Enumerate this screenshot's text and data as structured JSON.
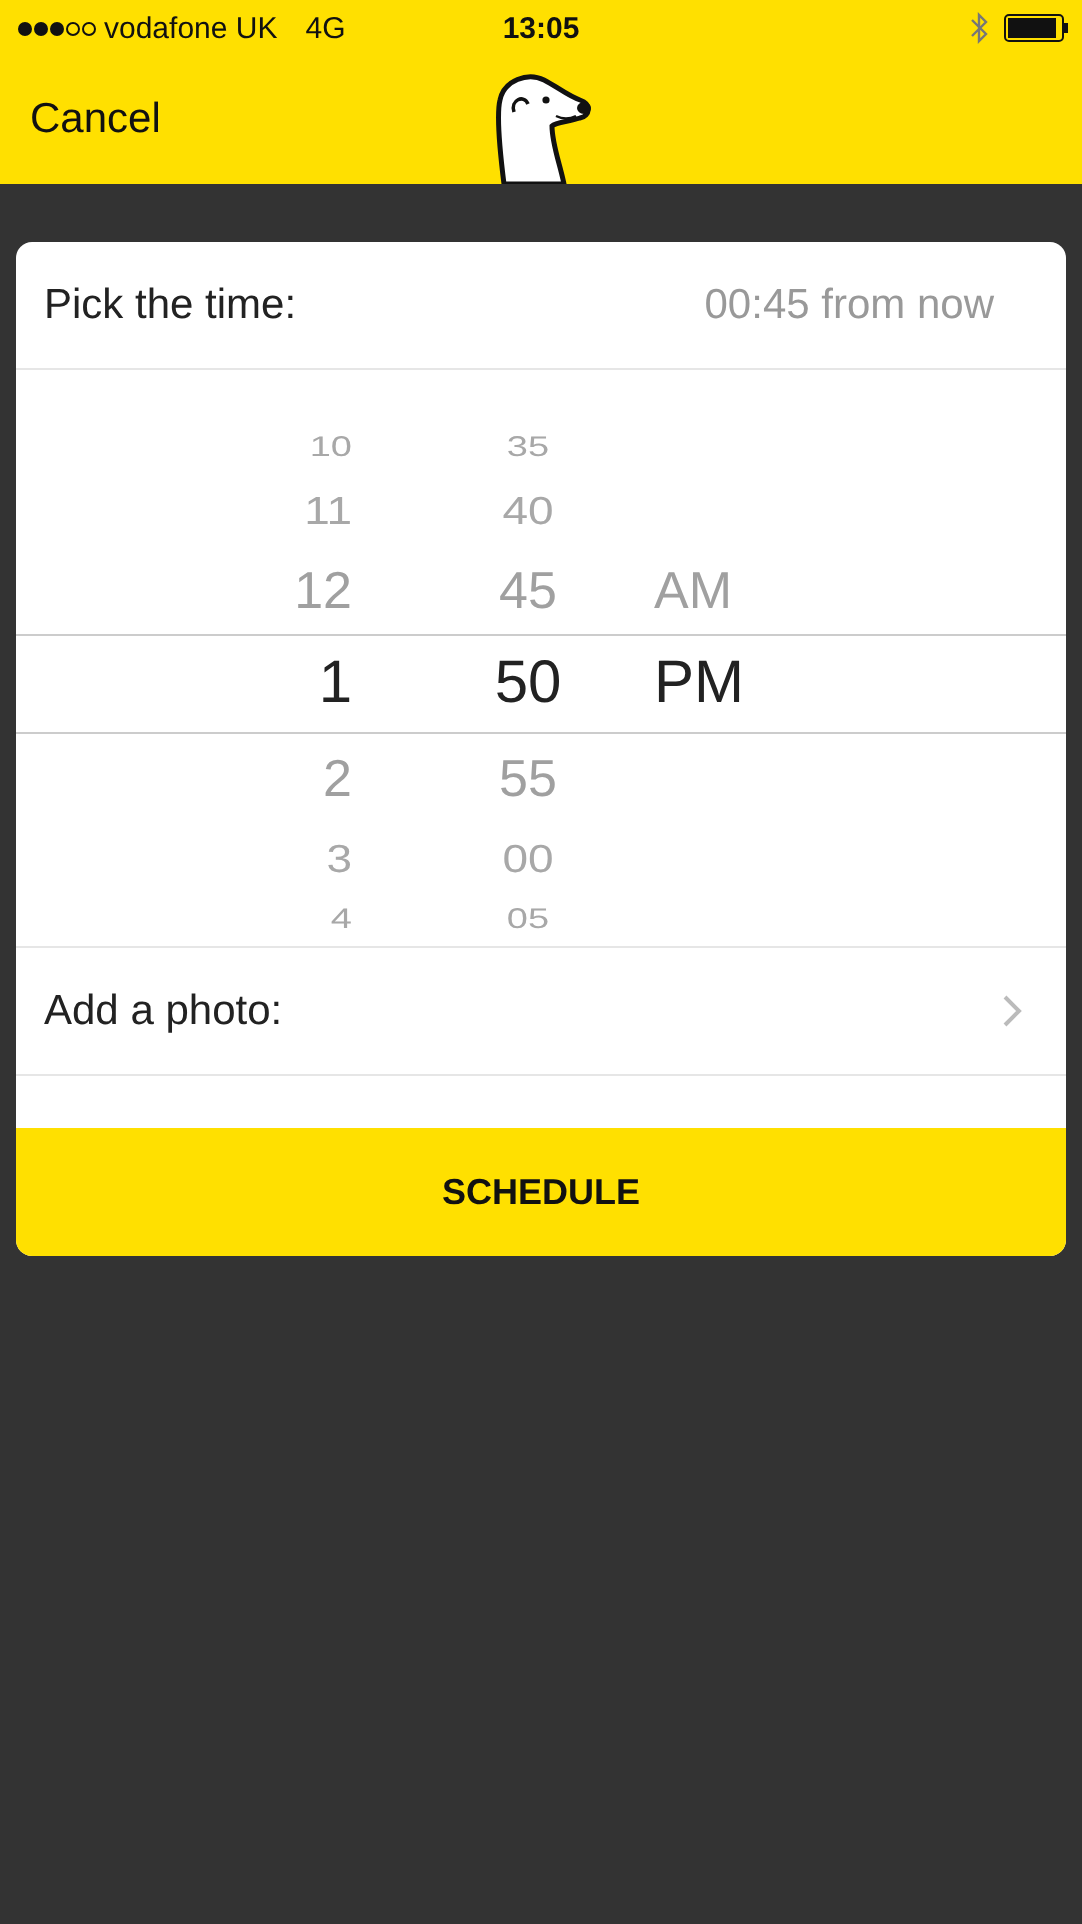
{
  "status_bar": {
    "carrier": "vodafone UK",
    "network": "4G",
    "time": "13:05"
  },
  "nav": {
    "cancel": "Cancel"
  },
  "time_row": {
    "label": "Pick the time:",
    "value": "00:45 from now"
  },
  "picker": {
    "rows": [
      {
        "hour": "10",
        "minute": "35",
        "selected": false
      },
      {
        "hour": "11",
        "minute": "40",
        "selected": false
      },
      {
        "hour": "12",
        "minute": "45",
        "ampm": "AM",
        "selected": false
      },
      {
        "hour": "1",
        "minute": "50",
        "ampm": "PM",
        "selected": true
      },
      {
        "hour": "2",
        "minute": "55",
        "selected": false
      },
      {
        "hour": "3",
        "minute": "00",
        "selected": false
      },
      {
        "hour": "4",
        "minute": "05",
        "selected": false
      }
    ]
  },
  "photo_row": {
    "label": "Add a photo:"
  },
  "schedule_button": "SCHEDULE"
}
